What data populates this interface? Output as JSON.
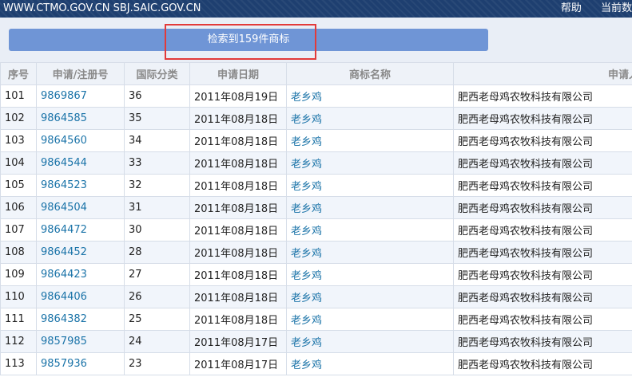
{
  "header": {
    "sites": "WWW.CTMO.GOV.CN  SBJ.SAIC.GOV.CN",
    "help": "帮助",
    "current": "当前数"
  },
  "result": {
    "text": "检索到159件商标"
  },
  "table": {
    "columns": [
      "序号",
      "申请/注册号",
      "国际分类",
      "申请日期",
      "商标名称",
      "申请人"
    ],
    "rows": [
      [
        "101",
        "9869867",
        "36",
        "2011年08月19日",
        "老乡鸡",
        "肥西老母鸡农牧科技有限公司"
      ],
      [
        "102",
        "9864585",
        "35",
        "2011年08月18日",
        "老乡鸡",
        "肥西老母鸡农牧科技有限公司"
      ],
      [
        "103",
        "9864560",
        "34",
        "2011年08月18日",
        "老乡鸡",
        "肥西老母鸡农牧科技有限公司"
      ],
      [
        "104",
        "9864544",
        "33",
        "2011年08月18日",
        "老乡鸡",
        "肥西老母鸡农牧科技有限公司"
      ],
      [
        "105",
        "9864523",
        "32",
        "2011年08月18日",
        "老乡鸡",
        "肥西老母鸡农牧科技有限公司"
      ],
      [
        "106",
        "9864504",
        "31",
        "2011年08月18日",
        "老乡鸡",
        "肥西老母鸡农牧科技有限公司"
      ],
      [
        "107",
        "9864472",
        "30",
        "2011年08月18日",
        "老乡鸡",
        "肥西老母鸡农牧科技有限公司"
      ],
      [
        "108",
        "9864452",
        "28",
        "2011年08月18日",
        "老乡鸡",
        "肥西老母鸡农牧科技有限公司"
      ],
      [
        "109",
        "9864423",
        "27",
        "2011年08月18日",
        "老乡鸡",
        "肥西老母鸡农牧科技有限公司"
      ],
      [
        "110",
        "9864406",
        "26",
        "2011年08月18日",
        "老乡鸡",
        "肥西老母鸡农牧科技有限公司"
      ],
      [
        "111",
        "9864382",
        "25",
        "2011年08月18日",
        "老乡鸡",
        "肥西老母鸡农牧科技有限公司"
      ],
      [
        "112",
        "9857985",
        "24",
        "2011年08月17日",
        "老乡鸡",
        "肥西老母鸡农牧科技有限公司"
      ],
      [
        "113",
        "9857936",
        "23",
        "2011年08月17日",
        "老乡鸡",
        "肥西老母鸡农牧科技有限公司"
      ]
    ]
  }
}
